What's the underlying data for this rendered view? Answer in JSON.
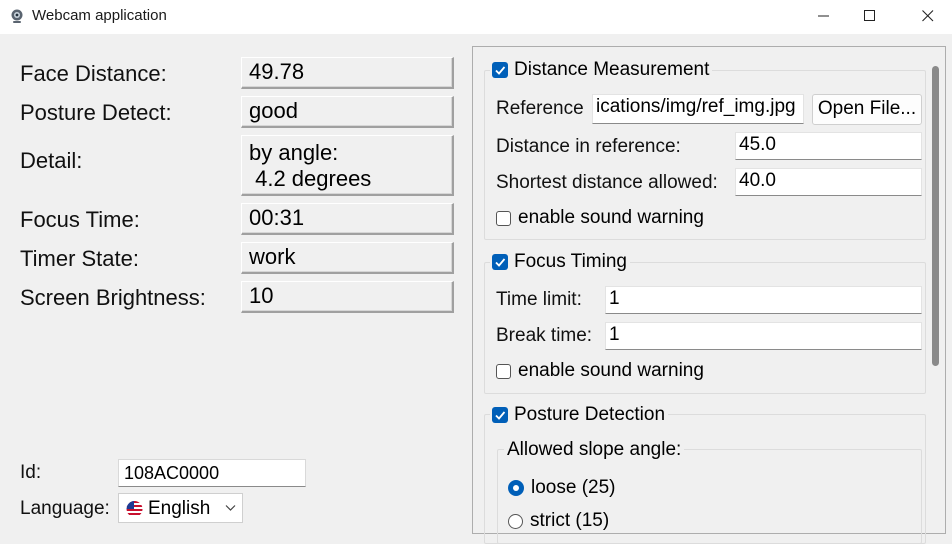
{
  "window": {
    "title": "Webcam application"
  },
  "stats": {
    "face_distance_label": "Face Distance:",
    "face_distance_value": "49.78",
    "posture_label": "Posture Detect:",
    "posture_value": "good",
    "detail_label": "Detail:",
    "detail_line1": "by angle:",
    "detail_line2": " 4.2 degrees",
    "focus_time_label": "Focus Time:",
    "focus_time_value": "00:31",
    "timer_state_label": "Timer State:",
    "timer_state_value": "work",
    "brightness_label": "Screen Brightness:",
    "brightness_value": "10"
  },
  "identity": {
    "id_label": "Id:",
    "id_value": "108AC0000",
    "language_label": "Language:",
    "language_value": "English"
  },
  "distance": {
    "title": "Distance Measurement",
    "enabled": true,
    "reference_label": "Reference",
    "reference_value": "ications/img/ref_img.jpg",
    "open_file_label": "Open File...",
    "ref_distance_label": "Distance in reference:",
    "ref_distance_value": "45.0",
    "shortest_label": "Shortest distance allowed:",
    "shortest_value": "40.0",
    "sound_label": "enable sound warning",
    "sound_enabled": false
  },
  "focus": {
    "title": "Focus Timing",
    "enabled": true,
    "time_limit_label": "Time limit:",
    "time_limit_value": "1",
    "break_label": "Break time:",
    "break_value": "1",
    "sound_label": "enable sound warning",
    "sound_enabled": false
  },
  "posture": {
    "title": "Posture Detection",
    "enabled": true,
    "slope_label": "Allowed slope angle:",
    "options": [
      "loose (25)",
      "strict (15)"
    ],
    "selected": "loose (25)"
  },
  "colors": {
    "accent": "#005fb8",
    "window_bg": "#f0f0f0"
  }
}
